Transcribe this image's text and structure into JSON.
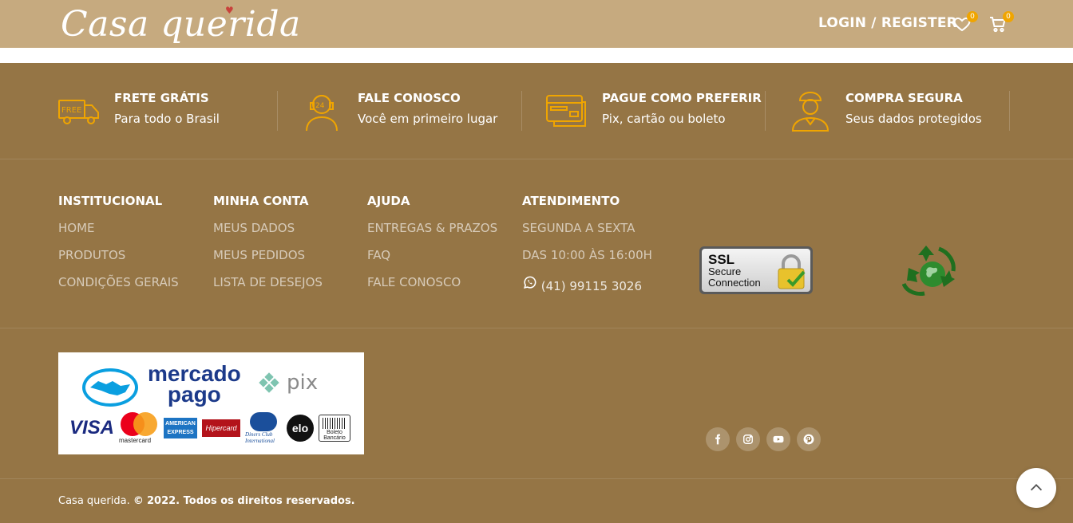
{
  "header": {
    "logo_text": "Casa querida",
    "login_label": "LOGIN / REGISTER",
    "wishlist_count": "0",
    "cart_count": "0"
  },
  "features": [
    {
      "icon": "free-shipping-truck-icon",
      "title": "FRETE GRÁTIS",
      "subtitle": "Para todo o Brasil"
    },
    {
      "icon": "support-agent-24h-icon",
      "title": "FALE CONOSCO",
      "subtitle": "Você em primeiro lugar"
    },
    {
      "icon": "credit-card-icon",
      "title": "PAGUE COMO PREFERIR",
      "subtitle": "Pix, cartão ou boleto"
    },
    {
      "icon": "security-guard-icon",
      "title": "COMPRA SEGURA",
      "subtitle": "Seus dados protegidos"
    }
  ],
  "columns": {
    "institucional": {
      "title": "INSTITUCIONAL",
      "links": [
        "HOME",
        "PRODUTOS",
        "CONDIÇÕES GERAIS"
      ]
    },
    "minha_conta": {
      "title": "MINHA CONTA",
      "links": [
        "MEUS DADOS",
        "MEUS PEDIDOS",
        "LISTA DE DESEJOS"
      ]
    },
    "ajuda": {
      "title": "AJUDA",
      "links": [
        "ENTREGAS & PRAZOS",
        "FAQ",
        "FALE CONOSCO"
      ]
    },
    "atendimento": {
      "title": "ATENDIMENTO",
      "lines": [
        "SEGUNDA A SEXTA",
        "DAS 10:00 ÀS 16:00H"
      ],
      "phone": "(41) 99115 3026"
    }
  },
  "ssl": {
    "line1": "SSL",
    "line2": "Secure",
    "line3": "Connection"
  },
  "payment": {
    "mp_line1": "mercado",
    "mp_line2": "pago",
    "pix": "pix",
    "visa": "VISA",
    "mastercard": "mastercard",
    "amex": "AMERICAN EXPRESS",
    "hipercard": "Hipercard",
    "diners": "Diners Club International",
    "elo": "elo",
    "boleto": "Boleto Bancário"
  },
  "social": [
    "facebook-icon",
    "instagram-icon",
    "youtube-icon",
    "pinterest-icon"
  ],
  "copyright": {
    "brand": "Casa querida.",
    "symbol": "©",
    "text": "2022. Todos os direitos reservados."
  },
  "colors": {
    "header_bg": "#c6aa7f",
    "footer_bg": "#957545",
    "icon_accent": "#f0a500"
  }
}
